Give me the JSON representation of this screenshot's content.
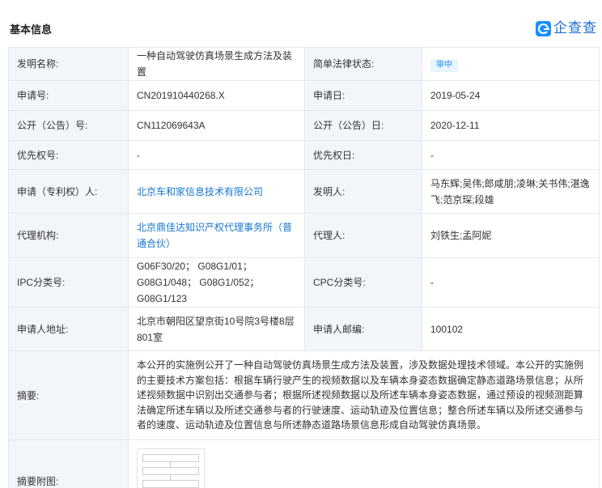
{
  "header": {
    "title": "基本信息",
    "brand": "企查查"
  },
  "rows": {
    "invention_name": {
      "label": "发明名称:",
      "value": "一种自动驾驶仿真场景生成方法及装置"
    },
    "legal_status": {
      "label": "简单法律状态:",
      "value": "审中"
    },
    "app_no": {
      "label": "申请号:",
      "value": "CN201910440268.X"
    },
    "app_date": {
      "label": "申请日:",
      "value": "2019-05-24"
    },
    "pub_no": {
      "label": "公开（公告）号:",
      "value": "CN112069643A"
    },
    "pub_date": {
      "label": "公开（公告）日:",
      "value": "2020-12-11"
    },
    "priority_no": {
      "label": "优先权号:",
      "value": "-"
    },
    "priority_date": {
      "label": "优先权日:",
      "value": "-"
    },
    "applicant": {
      "label": "申请（专利权）人:",
      "value": "北京车和家信息技术有限公司"
    },
    "inventor": {
      "label": "发明人:",
      "value": "马东辉;吴伟;郎咸朋;凌琳;关书伟;湛逸飞;范京琛;段雄"
    },
    "agency": {
      "label": "代理机构:",
      "value": "北京鼎佳达知识产权代理事务所（普通合伙）"
    },
    "agent": {
      "label": "代理人:",
      "value": "刘铁生;孟阿妮"
    },
    "ipc": {
      "label": "IPC分类号:",
      "value": "G06F30/20； G08G1/01； G08G1/048； G08G1/052； G08G1/123"
    },
    "cpc": {
      "label": "CPC分类号:",
      "value": "-"
    },
    "address": {
      "label": "申请人地址:",
      "value": "北京市朝阳区望京街10号院3号楼8层801室"
    },
    "postcode": {
      "label": "申请人邮编:",
      "value": "100102"
    },
    "abstract": {
      "label": "摘要:",
      "value": "本公开的实施例公开了一种自动驾驶仿真场景生成方法及装置，涉及数据处理技术领域。本公开的实施例的主要技术方案包括：根据车辆行驶产生的视频数据以及车辆本身姿态数据确定静态道路场景信息；从所述视频数据中识别出交通参与者；根据所述视频数据以及所述车辆本身姿态数据，通过预设的视频测距算法确定所述车辆以及所述交通参与者的行驶速度、运动轨迹及位置信息；整合所述车辆以及所述交通参与者的速度、运动轨迹及位置信息与所述静态道路场景信息形成自动驾驶仿真场景。"
    },
    "abstract_figure": {
      "label": "摘要附图:"
    }
  }
}
